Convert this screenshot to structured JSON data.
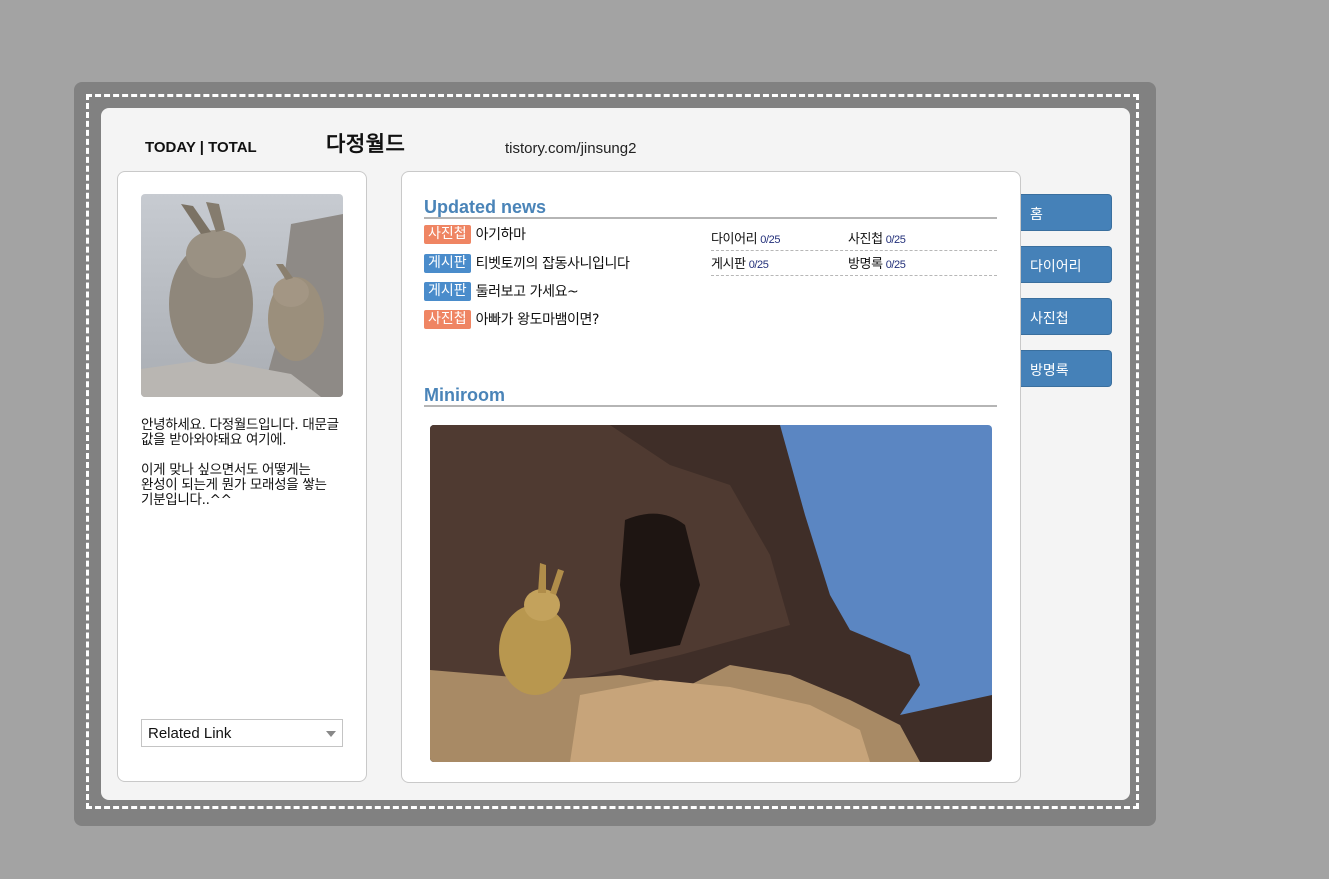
{
  "header": {
    "counter": "TODAY | TOTAL",
    "title": "다정월드",
    "url": "tistory.com/jinsung2"
  },
  "profile": {
    "text": "안녕하세요. 다정월드입니다. 대문글 값을 받아와야돼요 여기에.\n\n이게 맞나 싶으면서도 어떻게는 완성이 되는게 뭔가 모래성을 쌓는 기분입니다..^^",
    "related_link": "Related Link"
  },
  "updated_news": {
    "title": "Updated news",
    "items": [
      {
        "tag": "사진첩",
        "kind": "photo",
        "text": "아기하마"
      },
      {
        "tag": "게시판",
        "kind": "board",
        "text": "티벳토끼의 잡동사니입니다"
      },
      {
        "tag": "게시판",
        "kind": "board",
        "text": "둘러보고 가세요~"
      },
      {
        "tag": "사진첩",
        "kind": "photo",
        "text": "아빠가 왕도마뱀이면?"
      }
    ],
    "stats": [
      [
        {
          "label": "다이어리",
          "count": "0/25"
        },
        {
          "label": "사진첩",
          "count": "0/25"
        }
      ],
      [
        {
          "label": "게시판",
          "count": "0/25"
        },
        {
          "label": "방명록",
          "count": "0/25"
        }
      ]
    ]
  },
  "miniroom": {
    "title": "Miniroom"
  },
  "tabs": [
    "홈",
    "다이어리",
    "사진첩",
    "방명록"
  ],
  "colors": {
    "accent_blue": "#4581b8",
    "tag_photo": "#ef8563",
    "tag_board": "#4a8ccb"
  }
}
